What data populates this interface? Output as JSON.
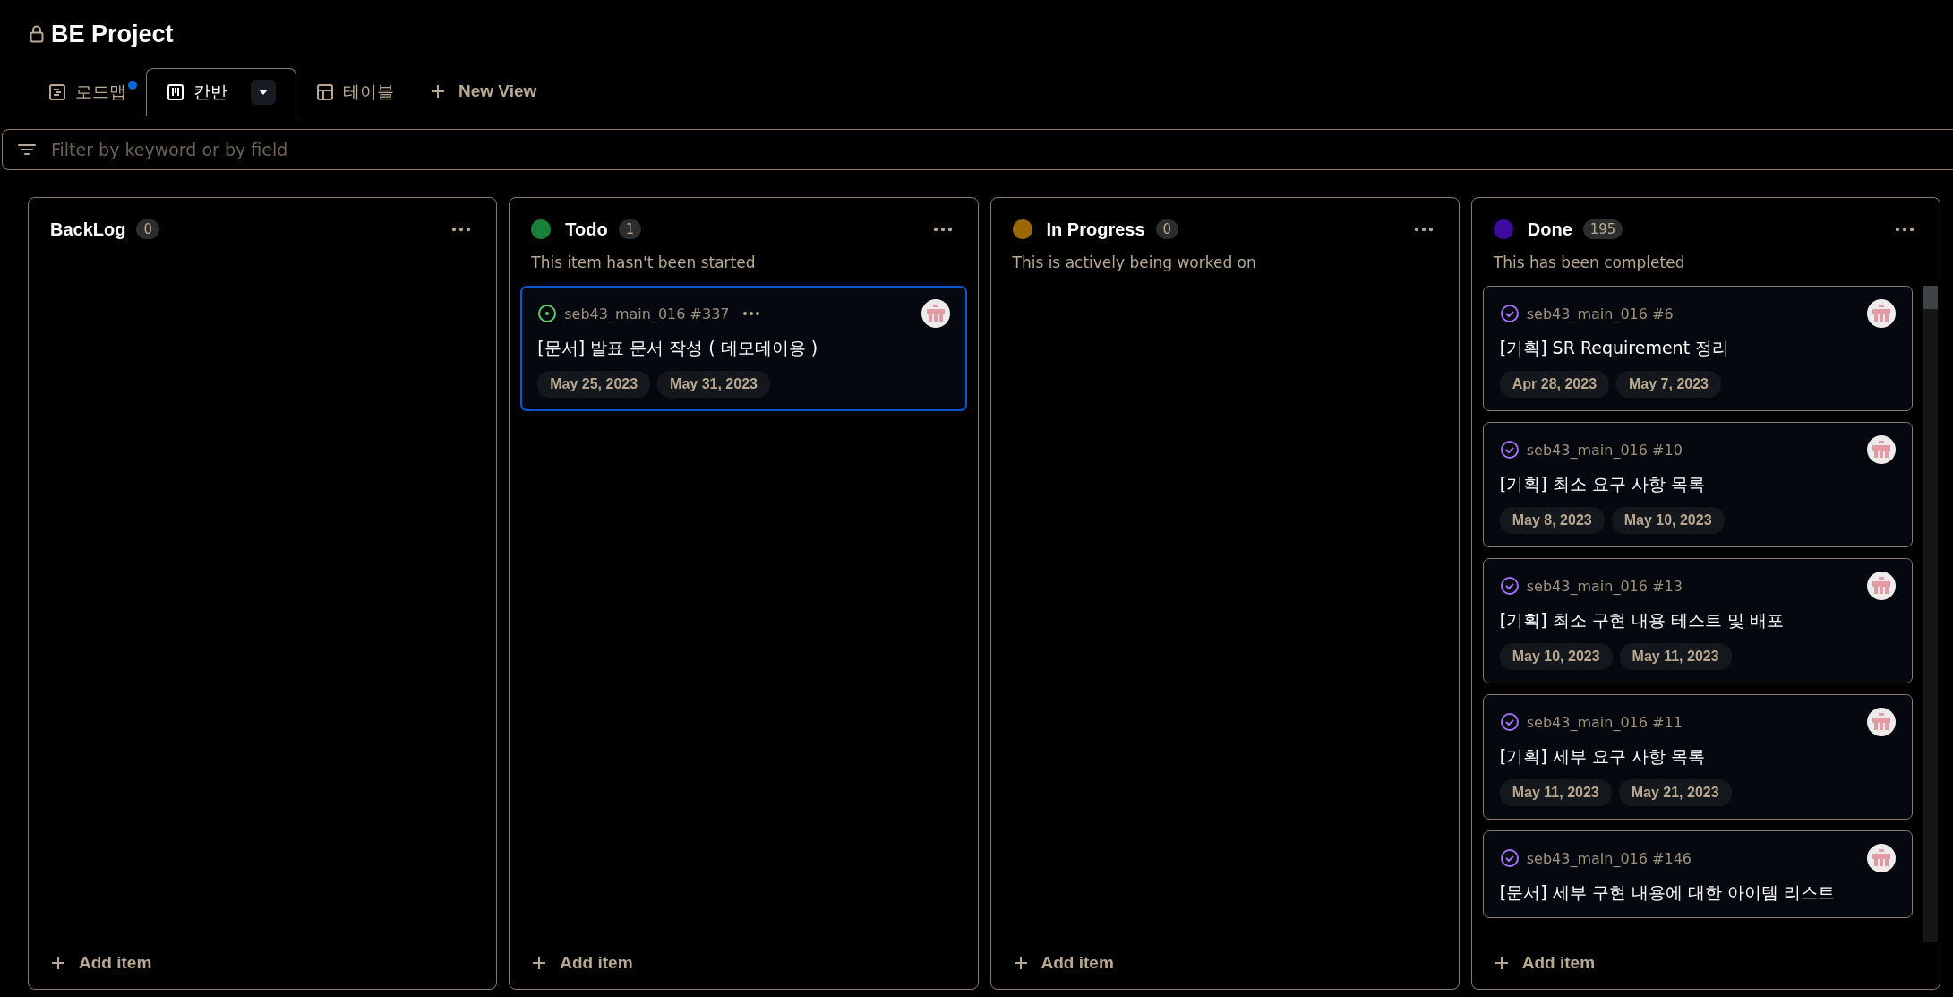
{
  "project": {
    "title": "BE Project",
    "locked": true
  },
  "tabs": [
    {
      "label": "로드맵",
      "kind": "roadmap",
      "selected": false,
      "notification": true
    },
    {
      "label": "칸반",
      "kind": "board",
      "selected": true,
      "notification": false
    },
    {
      "label": "테이블",
      "kind": "table",
      "selected": false,
      "notification": false
    }
  ],
  "new_view": {
    "label": "New View"
  },
  "filter": {
    "placeholder": "Filter by keyword or by field"
  },
  "columns": [
    {
      "name": "BackLog",
      "count": "0",
      "add_label": "Add item"
    },
    {
      "name": "Todo",
      "color": "#1a7f37",
      "count": "1",
      "description": "This item hasn't been started",
      "add_label": "Add item",
      "cards": [
        {
          "kind": "open",
          "ref": "seb43_main_016 #337",
          "title": "[문서] 발표 문서 작성 ( 데모데이용 )",
          "selected": true,
          "dates": [
            "May 25, 2023",
            "May 31, 2023"
          ]
        }
      ]
    },
    {
      "name": "In Progress",
      "color": "#9a6700",
      "count": "0",
      "description": "This is actively being worked on",
      "add_label": "Add item"
    },
    {
      "name": "Done",
      "color": "#3d0a9e",
      "count": "195",
      "description": "This has been completed",
      "add_label": "Add item",
      "cards": [
        {
          "kind": "closed",
          "ref": "seb43_main_016 #6",
          "title": "[기획] SR Requirement 정리",
          "selected": false,
          "dates": [
            "Apr 28, 2023",
            "May 7, 2023"
          ]
        },
        {
          "kind": "closed",
          "ref": "seb43_main_016 #10",
          "title": "[기획] 최소 요구 사항 목록",
          "selected": false,
          "dates": [
            "May 8, 2023",
            "May 10, 2023"
          ]
        },
        {
          "kind": "closed",
          "ref": "seb43_main_016 #13",
          "title": "[기획] 최소 구현 내용 테스트 및 배포",
          "selected": false,
          "dates": [
            "May 10, 2023",
            "May 11, 2023"
          ]
        },
        {
          "kind": "closed",
          "ref": "seb43_main_016 #11",
          "title": "[기획] 세부 요구 사항 목록",
          "selected": false,
          "dates": [
            "May 11, 2023",
            "May 21, 2023"
          ]
        },
        {
          "kind": "closed",
          "ref": "seb43_main_016 #146",
          "title": "[문서] 세부 구현 내용에 대한 아이템 리스트",
          "selected": false
        }
      ]
    }
  ]
}
